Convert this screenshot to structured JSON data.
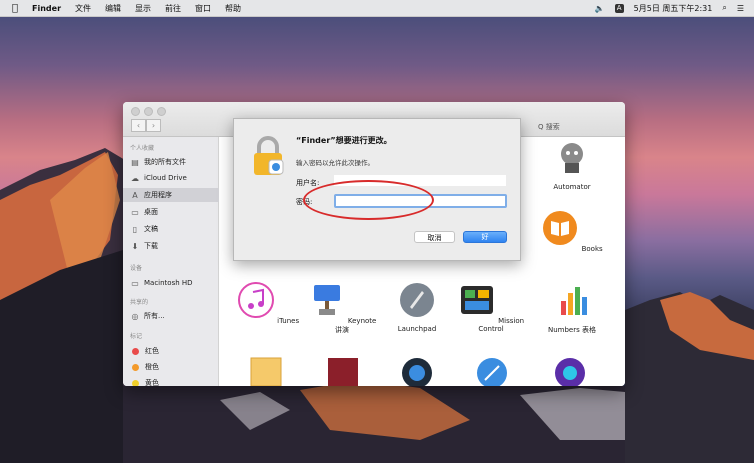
{
  "menubar": {
    "apple": "",
    "items": [
      "Finder",
      "文件",
      "编辑",
      "显示",
      "前往",
      "窗口",
      "帮助"
    ],
    "right": {
      "input_badge": "A",
      "datetime": "5月5日 周五下午2:31",
      "search_icon": "⌕",
      "menu_icon": "☰",
      "volume_icon": "🔈"
    }
  },
  "finder": {
    "nav_back": "‹",
    "nav_forward": "›",
    "toolbar_text": "Q 搜索",
    "sidebar": {
      "section_favorites": "个人收藏",
      "favorites": [
        {
          "label": "我的所有文件",
          "icon": "▤"
        },
        {
          "label": "iCloud Drive",
          "icon": "☁"
        },
        {
          "label": "应用程序",
          "icon": "A"
        },
        {
          "label": "桌面",
          "icon": "▭"
        },
        {
          "label": "文稿",
          "icon": "▯"
        },
        {
          "label": "下载",
          "icon": "⬇"
        }
      ],
      "section_devices": "设备",
      "devices": [
        {
          "label": "Macintosh HD",
          "icon": "▭"
        }
      ],
      "section_shared": "共享的",
      "shared": [
        {
          "label": "所有...",
          "icon": "◎"
        }
      ],
      "section_tags": "标记",
      "tags": [
        {
          "label": "红色",
          "color": "#e94b4b"
        },
        {
          "label": "橙色",
          "color": "#f39a2b"
        },
        {
          "label": "黄色",
          "color": "#f0cf2b"
        }
      ]
    },
    "apps": [
      {
        "label": "Automator"
      },
      {
        "label": "Books"
      },
      {
        "label": "iTunes"
      },
      {
        "label": "Keynote 讲演"
      },
      {
        "label": "Launchpad"
      },
      {
        "label": "Mission Control"
      },
      {
        "label": "Numbers 表格"
      }
    ]
  },
  "dialog": {
    "title": "“Finder”想要进行更改。",
    "message": "输入密码以允许此次操作。",
    "username_label": "用户名:",
    "username_value": "",
    "password_label": "密码:",
    "password_value": "",
    "cancel_label": "取消",
    "ok_label": "好"
  },
  "colors": {
    "accent": "#2f84f0",
    "highlight_oval": "#d82b2b",
    "focus_ring": "#7faee8"
  }
}
